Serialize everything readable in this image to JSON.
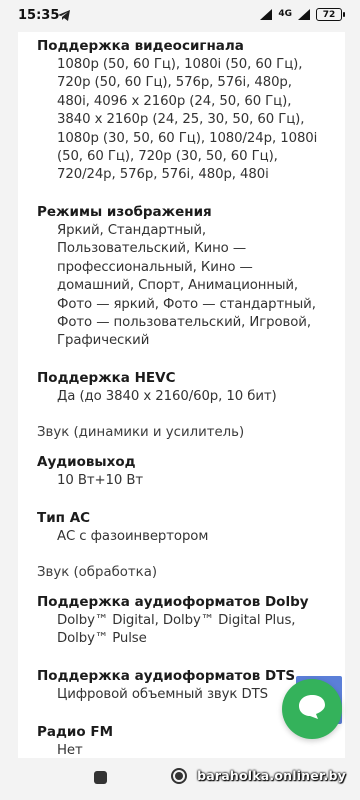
{
  "status": {
    "time": "15:35",
    "network": "4G",
    "network_sub": "4G",
    "battery": "72"
  },
  "specs": [
    {
      "title": "Поддержка видеосигнала",
      "value": "1080p (50, 60 Гц), 1080i (50, 60 Гц),\n720p (50, 60 Гц), 576p, 576i, 480p,\n480i, 4096 x 2160p (24, 50, 60 Гц),\n3840 x 2160p (24, 25, 30, 50, 60 Гц),\n1080p (30, 50, 60 Гц), 1080/24p, 1080i\n(50, 60 Гц), 720p (30, 50, 60 Гц),\n720/24p, 576p, 576i, 480p, 480i"
    },
    {
      "title": "Режимы изображения",
      "value": "Яркий, Стандартный,\nПользовательский, Кино —\nпрофессиональный, Кино —\nдомашний, Спорт, Анимационный,\nФото — яркий, Фото — стандартный,\nФото — пользовательский, Игровой,\nГрафический"
    },
    {
      "title": "Поддержка HEVC",
      "value": "Да (до 3840 x 2160/60p, 10 бит)"
    },
    {
      "title": "Аудиовыход",
      "value": "10 Вт+10 Вт"
    },
    {
      "title": "Тип АС",
      "value": "АС с фазоинвертором"
    },
    {
      "title": "Поддержка аудиоформатов Dolby",
      "value": "Dolby™ Digital, Dolby™ Digital Plus,\nDolby™ Pulse"
    },
    {
      "title": "Поддержка аудиоформатов DTS",
      "value": "Цифровой объемный звук DTS"
    },
    {
      "title": "Радио FM",
      "value": "Нет"
    }
  ],
  "sections": {
    "sound_speakers": "Звук (динамики и усилитель)",
    "sound_processing": "Звук (обработка)"
  },
  "watermark": "baraholka.onliner.by",
  "colors": {
    "chat_button": "#34b25b",
    "blue_button": "#5b7fd8"
  }
}
